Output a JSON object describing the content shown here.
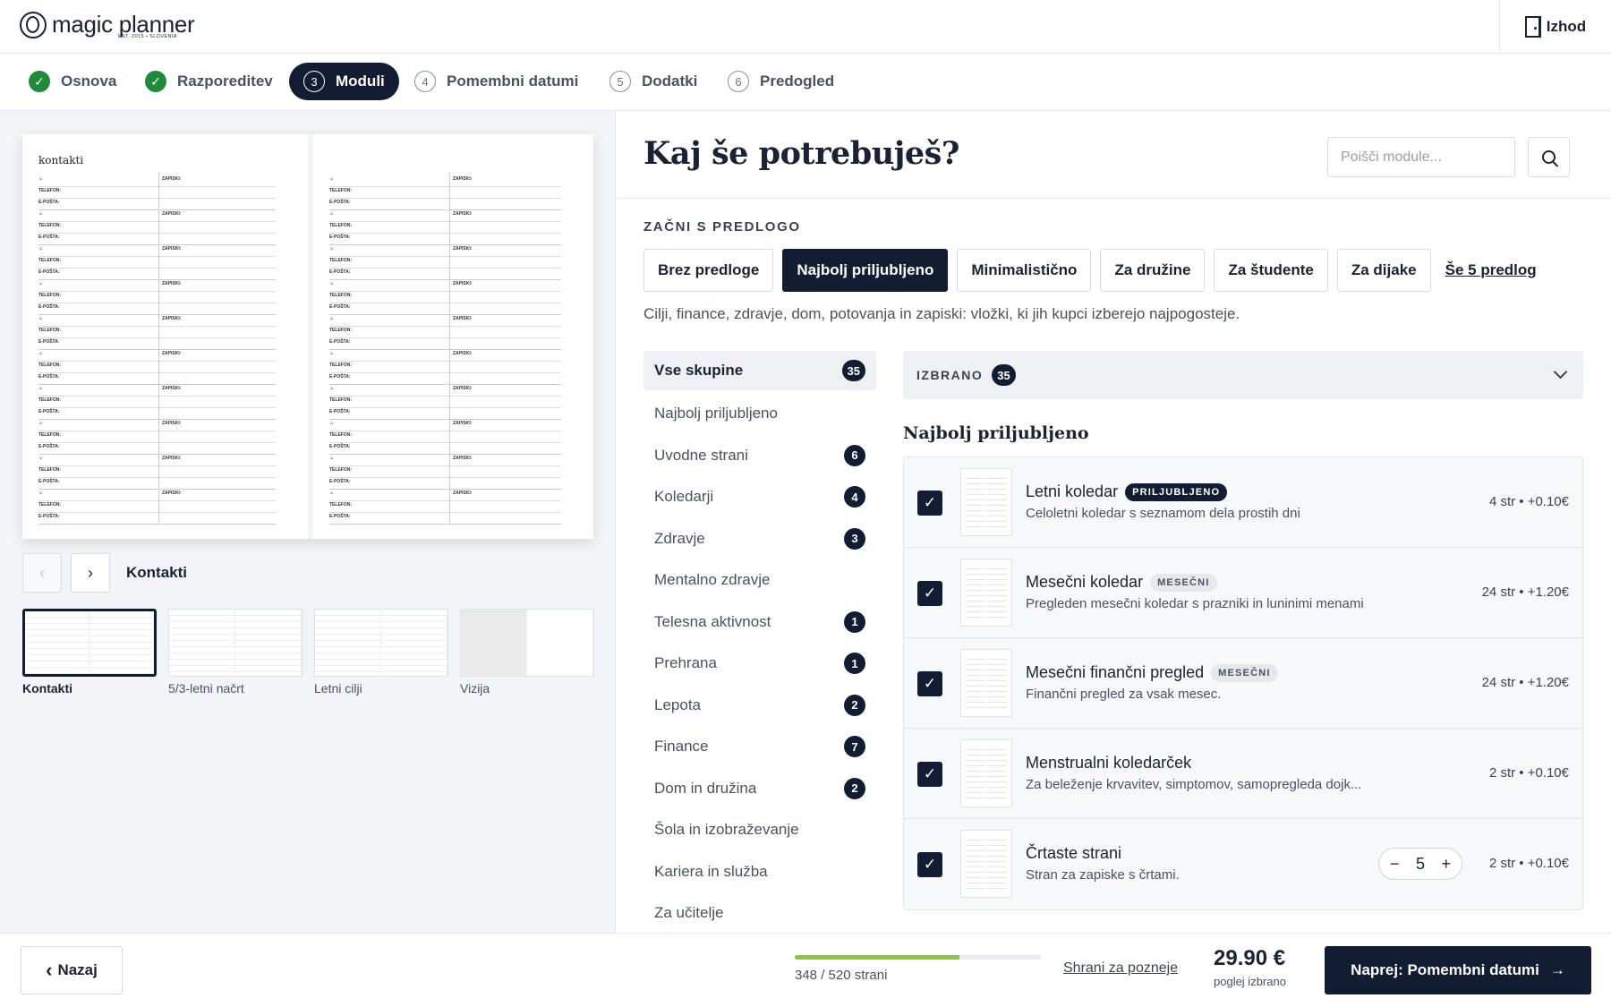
{
  "header": {
    "logo_name": "magic planner",
    "logo_sub": "EST. 2015 • SLOVENIA",
    "exit_label": "Izhod"
  },
  "steps": [
    {
      "num": "1",
      "label": "Osnova",
      "done": true
    },
    {
      "num": "2",
      "label": "Razporeditev",
      "done": true
    },
    {
      "num": "3",
      "label": "Moduli",
      "active": true
    },
    {
      "num": "4",
      "label": "Pomembni datumi"
    },
    {
      "num": "5",
      "label": "Dodatki"
    },
    {
      "num": "6",
      "label": "Predogled"
    }
  ],
  "preview": {
    "page_title": "kontakti",
    "field_name_icon": "person-icon",
    "field_notes": "ZAPISKI:",
    "field_phone": "TELEFON:",
    "field_email": "E-POŠTA:",
    "current_label": "Kontakti",
    "thumbnails": [
      {
        "label": "Kontakti",
        "selected": true
      },
      {
        "label": "5/3-letni načrt"
      },
      {
        "label": "Letni cilji"
      },
      {
        "label": "Vizija"
      }
    ]
  },
  "main": {
    "title": "Kaj še potrebuješ?",
    "search_placeholder": "Poišči module...",
    "templates_label": "ZAČNI S PREDLOGO",
    "templates": [
      {
        "label": "Brez predloge"
      },
      {
        "label": "Najbolj priljubljeno",
        "active": true
      },
      {
        "label": "Minimalistično"
      },
      {
        "label": "Za družine"
      },
      {
        "label": "Za študente"
      },
      {
        "label": "Za dijake"
      }
    ],
    "more_templates": "Še 5 predlog",
    "template_desc": "Cilji, finance, zdravje, dom, potovanja in zapiski: vložki, ki jih kupci izberejo najpogosteje.",
    "categories": [
      {
        "label": "Vse skupine",
        "count": "35",
        "active": true
      },
      {
        "label": "Najbolj priljubljeno",
        "count": ""
      },
      {
        "label": "Uvodne strani",
        "count": "6"
      },
      {
        "label": "Koledarji",
        "count": "4"
      },
      {
        "label": "Zdravje",
        "count": "3"
      },
      {
        "label": "Mentalno zdravje",
        "count": ""
      },
      {
        "label": "Telesna aktivnost",
        "count": "1"
      },
      {
        "label": "Prehrana",
        "count": "1"
      },
      {
        "label": "Lepota",
        "count": "2"
      },
      {
        "label": "Finance",
        "count": "7"
      },
      {
        "label": "Dom in družina",
        "count": "2"
      },
      {
        "label": "Šola in izobraževanje",
        "count": ""
      },
      {
        "label": "Kariera in služba",
        "count": ""
      },
      {
        "label": "Za učitelje",
        "count": ""
      }
    ],
    "selected_label": "IZBRANO",
    "selected_count": "35",
    "group_title": "Najbolj priljubljeno",
    "modules": [
      {
        "title": "Letni koledar",
        "badge": "PRILJUBLJENO",
        "badge_dark": true,
        "desc": "Celoletni koledar s seznamom dela prostih dni",
        "price": "4 str • +0.10€"
      },
      {
        "title": "Mesečni koledar",
        "badge": "MESEČNI",
        "desc": "Pregleden mesečni koledar s prazniki in luninimi menami",
        "price": "24 str • +1.20€"
      },
      {
        "title": "Mesečni finančni pregled",
        "badge": "MESEČNI",
        "desc": "Finančni pregled za vsak mesec.",
        "price": "24 str • +1.20€"
      },
      {
        "title": "Menstrualni koledarček",
        "badge": "",
        "desc": "Za beleženje krvavitev, simptomov, samopregleda dojk...",
        "price": "2 str • +0.10€"
      },
      {
        "title": "Črtaste strani",
        "badge": "",
        "desc": "Stran za zapiske s črtami.",
        "price": "2 str • +0.10€",
        "qty": "5"
      }
    ]
  },
  "footer": {
    "back_label": "Nazaj",
    "pages_used": 348,
    "pages_total": 520,
    "pages_text": "348 / 520 strani",
    "save_label": "Shrani za pozneje",
    "total": "29.90 €",
    "total_sub": "poglej izbrano",
    "next_label": "Naprej: Pomembni datumi"
  },
  "colors": {
    "primary": "#121c33",
    "success": "#1f8a3b",
    "progress": "#8cc63f"
  }
}
